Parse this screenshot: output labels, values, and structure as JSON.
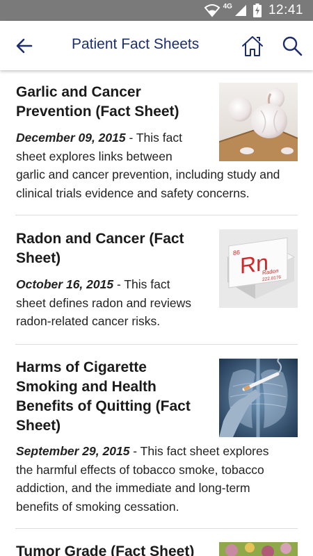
{
  "status_bar": {
    "time": "12:41",
    "network": "4G",
    "icons": [
      "wifi-icon",
      "signal-icon",
      "battery-charging-icon"
    ]
  },
  "app_bar": {
    "title": "Patient Fact Sheets",
    "back_icon": "arrow-left-icon",
    "home_icon": "home-icon",
    "search_icon": "search-icon",
    "accent_color": "#1d2e6e"
  },
  "fact_sheets": [
    {
      "title_lines": [
        "Garlic and Cancer",
        "Prevention (Fact Sheet)"
      ],
      "date": "December 09, 2015",
      "desc_lines": [
        " - This fact",
        "sheet explores links between",
        "garlic and cancer prevention, including study and",
        "clinical trials evidence and safety concerns."
      ],
      "image": "garlic-image"
    },
    {
      "title_lines": [
        "Radon and Cancer (Fact",
        "Sheet)"
      ],
      "date": "October 16, 2015",
      "desc_lines": [
        " - This fact",
        "sheet defines radon and reviews",
        "radon-related cancer risks."
      ],
      "image": "radon-element-image",
      "image_text": {
        "number": "86",
        "symbol": "Rn",
        "name": "Radon",
        "mass": "222.0176"
      }
    },
    {
      "title_lines": [
        "Harms of Cigarette",
        "Smoking and Health",
        "Benefits of Quitting (Fact",
        "Sheet)"
      ],
      "date": "September 29, 2015",
      "desc_lines": [
        " - This fact sheet explores",
        "the harmful effects of tobacco smoke, tobacco",
        "addiction, and the immediate and long-term",
        "benefits of smoking cessation."
      ],
      "image": "cigarette-xray-image"
    },
    {
      "title_lines": [
        "Tumor Grade (Fact Sheet)"
      ],
      "image": "tumor-grade-image"
    }
  ]
}
